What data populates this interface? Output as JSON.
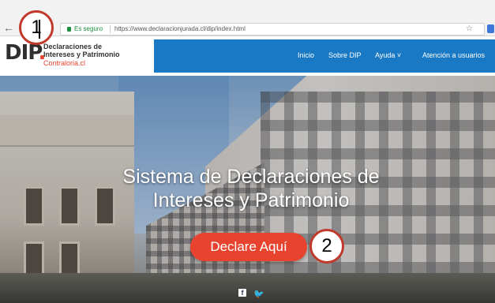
{
  "browser": {
    "secure_label": "Es seguro",
    "url": "https://www.declaracionjurada.cl/dip/index.html",
    "back_icon": "arrow-left-icon",
    "star_icon": "star-icon",
    "extension_icon": "extension-icon"
  },
  "site": {
    "logo_text": "DIP",
    "logo_dot": ".",
    "logo_line1": "Declaraciones de",
    "logo_line2": "Intereses y Patrimonio",
    "logo_line3": "Contraloria.cl",
    "nav": [
      {
        "label": "Inicio"
      },
      {
        "label": "Sobre DIP"
      },
      {
        "label": "Ayuda ˅"
      },
      {
        "label": "Atención a usuarios"
      }
    ],
    "colors": {
      "navbar": "#1a79c4",
      "accent": "#e8432e"
    }
  },
  "hero": {
    "title_line1": "Sistema de Declaraciones de",
    "title_line2": "Intereses y Patrimonio",
    "cta_label": "Declare Aquí",
    "social": [
      {
        "icon": "facebook-icon",
        "label": "f"
      },
      {
        "icon": "twitter-icon",
        "label": "🐦"
      }
    ]
  },
  "callouts": [
    {
      "label": "1"
    },
    {
      "label": "2"
    }
  ]
}
